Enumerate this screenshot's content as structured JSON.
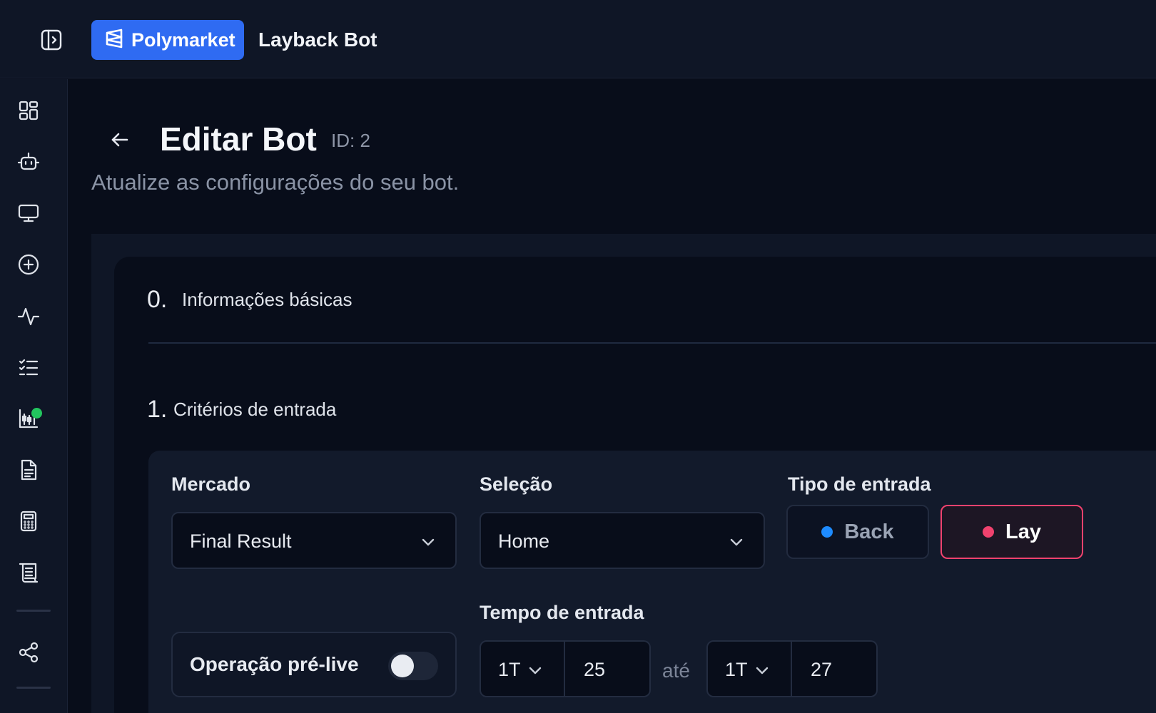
{
  "header": {
    "brand": "Polymarket",
    "app_title": "Layback Bot"
  },
  "page": {
    "title": "Editar Bot",
    "id_label": "ID: 2",
    "subtitle": "Atualize as configurações do seu bot."
  },
  "steps": [
    {
      "number": "0.",
      "label": "Informações básicas"
    },
    {
      "number": "1.",
      "label": "Critérios de entrada"
    }
  ],
  "form": {
    "market": {
      "label": "Mercado",
      "value": "Final Result"
    },
    "selection": {
      "label": "Seleção",
      "value": "Home"
    },
    "entry_type": {
      "label": "Tipo de entrada",
      "back": "Back",
      "lay": "Lay",
      "selected": "Lay",
      "back_color": "#1e8bff",
      "lay_color": "#f0426e"
    },
    "prelive": {
      "label": "Operação pré-live",
      "enabled": false
    },
    "entry_time": {
      "label": "Tempo de entrada",
      "from_half": "1T",
      "from_minute": "25",
      "separator": "até",
      "to_half": "1T",
      "to_minute": "27"
    }
  },
  "sidebar": {
    "icons": [
      "dashboard-icon",
      "bot-icon",
      "monitor-icon",
      "add-circle-icon",
      "activity-icon",
      "checklist-icon",
      "chart-live-icon",
      "document-icon",
      "calculator-icon",
      "scroll-icon",
      "share-icon"
    ]
  },
  "colors": {
    "accent": "#2f6bf2",
    "live": "#22c55e"
  }
}
